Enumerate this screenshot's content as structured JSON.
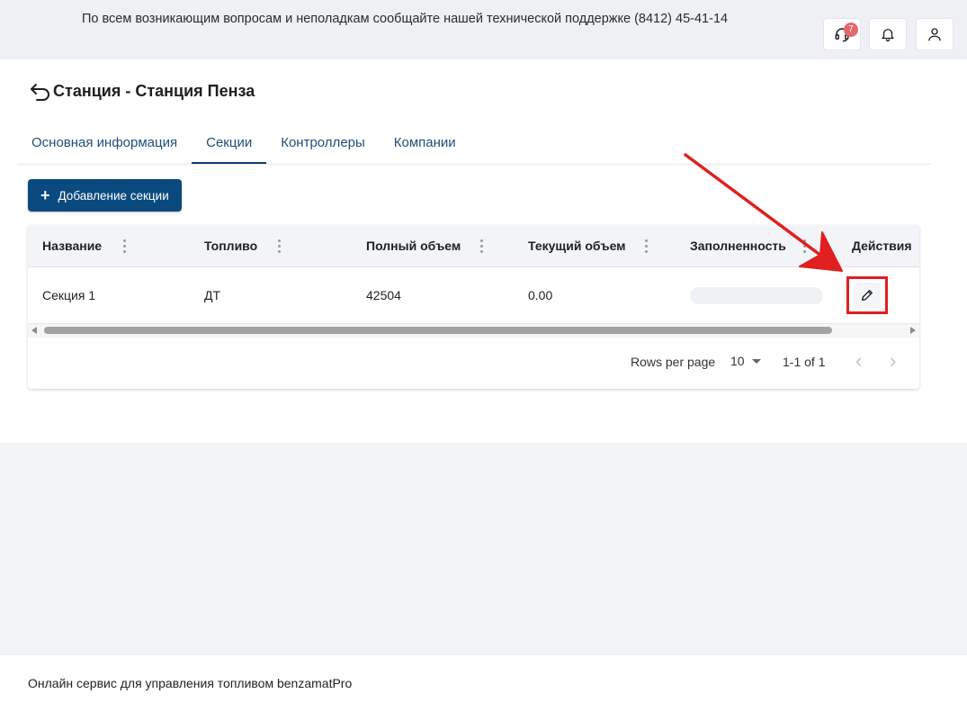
{
  "header": {
    "notice": "По всем возникающим вопросам и неполадкам сообщайте нашей технической поддержке (8412) 45-41-14",
    "support_badge": "7",
    "icons": [
      "headset-icon",
      "bell-icon",
      "user-icon"
    ]
  },
  "page": {
    "title": "Станция - Станция Пенза",
    "tabs": [
      {
        "label": "Основная информация",
        "active": false
      },
      {
        "label": "Секции",
        "active": true
      },
      {
        "label": "Контроллеры",
        "active": false
      },
      {
        "label": "Компании",
        "active": false
      }
    ],
    "add_button": "Добавление секции"
  },
  "table": {
    "columns": [
      "Название",
      "Топливо",
      "Полный объем",
      "Текущий объем",
      "Заполненность",
      "Действия"
    ],
    "rows": [
      {
        "name": "Секция 1",
        "fuel": "ДТ",
        "full_volume": "42504",
        "current_volume": "0.00",
        "fill_fraction": 0
      }
    ]
  },
  "pagination": {
    "rows_per_page_label": "Rows per page",
    "rows_per_page_value": "10",
    "range": "1-1 of 1"
  },
  "footer": {
    "text": "Онлайн сервис для управления топливом benzamatPro"
  },
  "colors": {
    "primary": "#0b4a7f",
    "annotation": "#e02020",
    "badge": "#e5686e"
  }
}
